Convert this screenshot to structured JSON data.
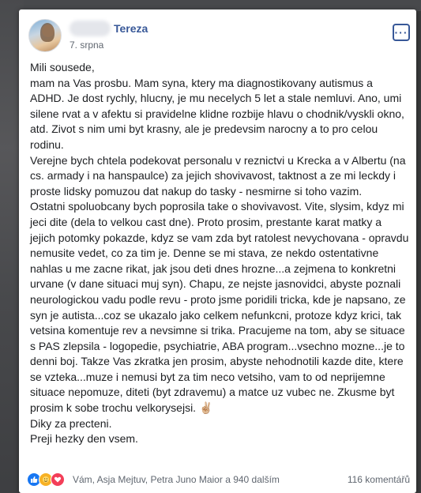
{
  "post": {
    "author": "Tereza",
    "date": "7. srpna",
    "more_label": "···",
    "paragraphs": [
      "Mili sousede,\nmam na Vas prosbu. Mam syna, ktery ma diagnostikovany autismus a ADHD. Je dost rychly, hlucny, je mu necelych 5 let a stale nemluvi. Ano, umi silene rvat a v afektu si pravidelne klidne rozbije hlavu o chodnik/vyskli okno, atd. Zivot s nim umi byt krasny, ale je predevsim narocny a to pro celou rodinu.",
      "Verejne bych chtela podekovat personalu v reznictvi u Krecka a v Albertu (na cs. armady i na hanspaulce) za jejich shovivavost, taktnost a ze mi leckdy i proste lidsky pomuzou dat nakup do tasky - nesmirne si toho vazim.",
      "Ostatni spoluobcany bych poprosila take o shovivavost. Vite, slysim, kdyz mi jeci dite (dela to velkou cast dne). Proto prosim, prestante karat matky a jejich potomky pokazde, kdyz se vam zda byt ratolest nevychovana - opravdu nemusite vedet, co za tim je. Denne se mi stava, ze nekdo ostentativne nahlas u me zacne rikat, jak jsou deti dnes hrozne...a zejmena to konkretni urvane (v dane situaci muj syn). Chapu, ze nejste jasnovidci, abyste poznali neurologickou vadu podle revu - proto jsme poridili tricka, kde je napsano, ze syn je autista...coz se ukazalo jako celkem nefunkcni, protoze kdyz krici, tak vetsina komentuje rev a nevsimne si trika. Pracujeme na tom, aby se situace s PAS zlepsila - logopedie, psychiatrie, ABA program...vsechno mozne...je to denni boj. Takze Vas zkratka jen prosim, abyste nehodnotili kazde dite, ktere se vzteka...muze i nemusi byt za tim neco vetsiho, vam to od neprijemne situace nepomuze, diteti (byt zdravemu) a matce uz vubec ne. Zkusme byt prosim k sobe trochu velkorysejsi. ✌🏼",
      "Diky za precteni.\nPreji hezky den vsem."
    ]
  },
  "footer": {
    "reaction_names": "Vám, Asja Mejtuv, Petra Juno Maior a 940 dalším",
    "comments": "116 komentářů"
  },
  "colors": {
    "accent": "#385898",
    "text": "#1c1e21",
    "meta": "#606770",
    "like": "#1877f2",
    "care": "#f7b125",
    "love": "#f33e58"
  }
}
